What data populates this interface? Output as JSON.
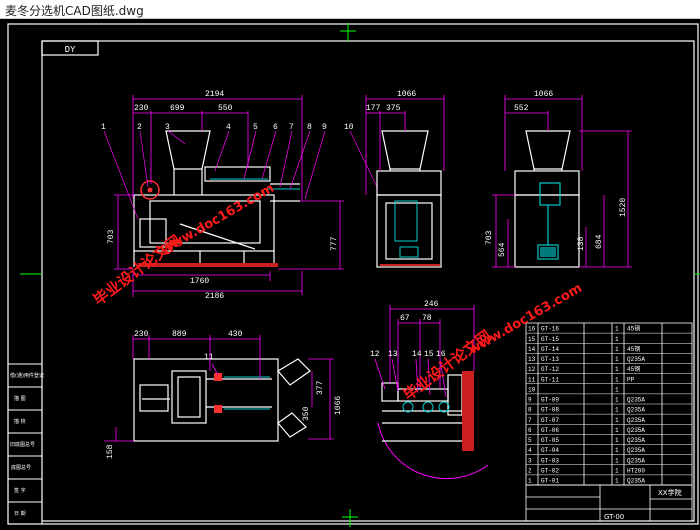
{
  "window": {
    "title": "麦冬分选机CAD图纸.dwg"
  },
  "drawing": {
    "corner_tag": "DY",
    "dims_front": {
      "overall": "2194",
      "d230": "230",
      "d699": "699",
      "d550": "550",
      "h703": "703",
      "h777": "777",
      "b1760": "1760",
      "b2186": "2186"
    },
    "dims_side1": {
      "w1066": "1066",
      "d177": "177",
      "d375": "375"
    },
    "dims_side2": {
      "w1066": "1066",
      "d552": "552",
      "h703": "703",
      "h564": "564",
      "h138": "138",
      "h684": "684",
      "h1520": "1520"
    },
    "dims_plan": {
      "d230": "230",
      "d889": "889",
      "d430": "430",
      "h377": "377",
      "h350": "350",
      "h1066": "1066",
      "h158": "158"
    },
    "dims_detail": {
      "d246": "246",
      "d67": "67",
      "d78": "78"
    },
    "callouts_front": [
      "1",
      "2",
      "3",
      "4",
      "5",
      "6",
      "7",
      "8",
      "9",
      "10"
    ],
    "callout_plan": "11",
    "callouts_detail": [
      "12",
      "13",
      "14",
      "15",
      "16"
    ],
    "parts_list": [
      {
        "no": "16",
        "code": "GT-16",
        "qty": "1",
        "mat": "45钢"
      },
      {
        "no": "15",
        "code": "GT-15",
        "qty": "1",
        "mat": ""
      },
      {
        "no": "14",
        "code": "GT-14",
        "qty": "1",
        "mat": "45钢"
      },
      {
        "no": "13",
        "code": "GT-13",
        "qty": "1",
        "mat": "Q235A"
      },
      {
        "no": "12",
        "code": "GT-12",
        "qty": "1",
        "mat": "45钢"
      },
      {
        "no": "11",
        "code": "GT-11",
        "qty": "1",
        "mat": "PP"
      },
      {
        "no": "10",
        "code": "",
        "qty": "1",
        "mat": ""
      },
      {
        "no": "9",
        "code": "GT-09",
        "qty": "1",
        "mat": "Q235A"
      },
      {
        "no": "8",
        "code": "GT-08",
        "qty": "1",
        "mat": "Q235A"
      },
      {
        "no": "7",
        "code": "GT-07",
        "qty": "1",
        "mat": "Q235A"
      },
      {
        "no": "6",
        "code": "GT-06",
        "qty": "1",
        "mat": "Q235A"
      },
      {
        "no": "5",
        "code": "GT-05",
        "qty": "1",
        "mat": "Q235A"
      },
      {
        "no": "4",
        "code": "GT-04",
        "qty": "1",
        "mat": "Q235A"
      },
      {
        "no": "3",
        "code": "GT-03",
        "qty": "1",
        "mat": "Q235A"
      },
      {
        "no": "2",
        "code": "GT-02",
        "qty": "1",
        "mat": "HT200"
      },
      {
        "no": "1",
        "code": "GT-01",
        "qty": "1",
        "mat": "Q235A"
      }
    ],
    "title_block": {
      "school": "XX学院",
      "drawing_no": "GT-00"
    },
    "left_labels": [
      "借(通)用件登记",
      "描 图",
      "描 校",
      "旧底图总号",
      "底图总号",
      "签 字",
      "日 期"
    ]
  },
  "watermarks": [
    "毕业设计论文网",
    "www.doc163.com",
    "毕业设计论文网",
    "www.doc163.com"
  ],
  "colors": {
    "bg": "#000000",
    "border": "#ffffff",
    "part": "#ffffff",
    "dim": "#ff00ff",
    "leader": "#ff00ff",
    "table": "#ffffff",
    "watermark": "#ff1a1a"
  }
}
